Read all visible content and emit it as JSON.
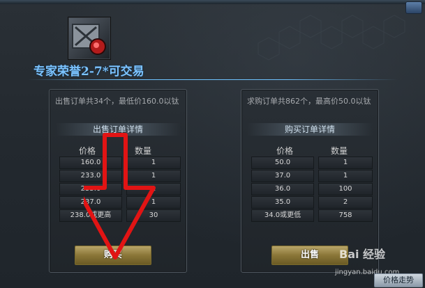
{
  "item": {
    "title": "专家荣誉2-7*可交易"
  },
  "sell_panel": {
    "summary": "出售订单共34个，最低价160.0以钛",
    "detail_title": "出售订单详情",
    "col_price": "价格",
    "col_qty": "数量",
    "rows": [
      {
        "price": "160.0",
        "qty": "1"
      },
      {
        "price": "233.0",
        "qty": "1"
      },
      {
        "price": "235.0",
        "qty": "1"
      },
      {
        "price": "237.0",
        "qty": "1"
      },
      {
        "price": "238.0或更高",
        "qty": "30"
      }
    ],
    "button": "购买"
  },
  "buy_panel": {
    "summary": "求购订单共862个，最高价50.0以钛",
    "detail_title": "购买订单详情",
    "col_price": "价格",
    "col_qty": "数量",
    "rows": [
      {
        "price": "50.0",
        "qty": "1"
      },
      {
        "price": "37.0",
        "qty": "1"
      },
      {
        "price": "36.0",
        "qty": "100"
      },
      {
        "price": "35.0",
        "qty": "2"
      },
      {
        "price": "34.0或更低",
        "qty": "758"
      }
    ],
    "button": "出售"
  },
  "footer": {
    "trend_button": "价格走势",
    "watermark": "Bai 经验",
    "watermark_sub": "jingyan.baidu.com"
  },
  "colors": {
    "title_blue": "#7cc3ff",
    "arrow_red": "#e11414",
    "button_gold": "#8a7638"
  },
  "icons": {
    "item": "supply-crate-icon",
    "corner": "window-corner-icon"
  }
}
